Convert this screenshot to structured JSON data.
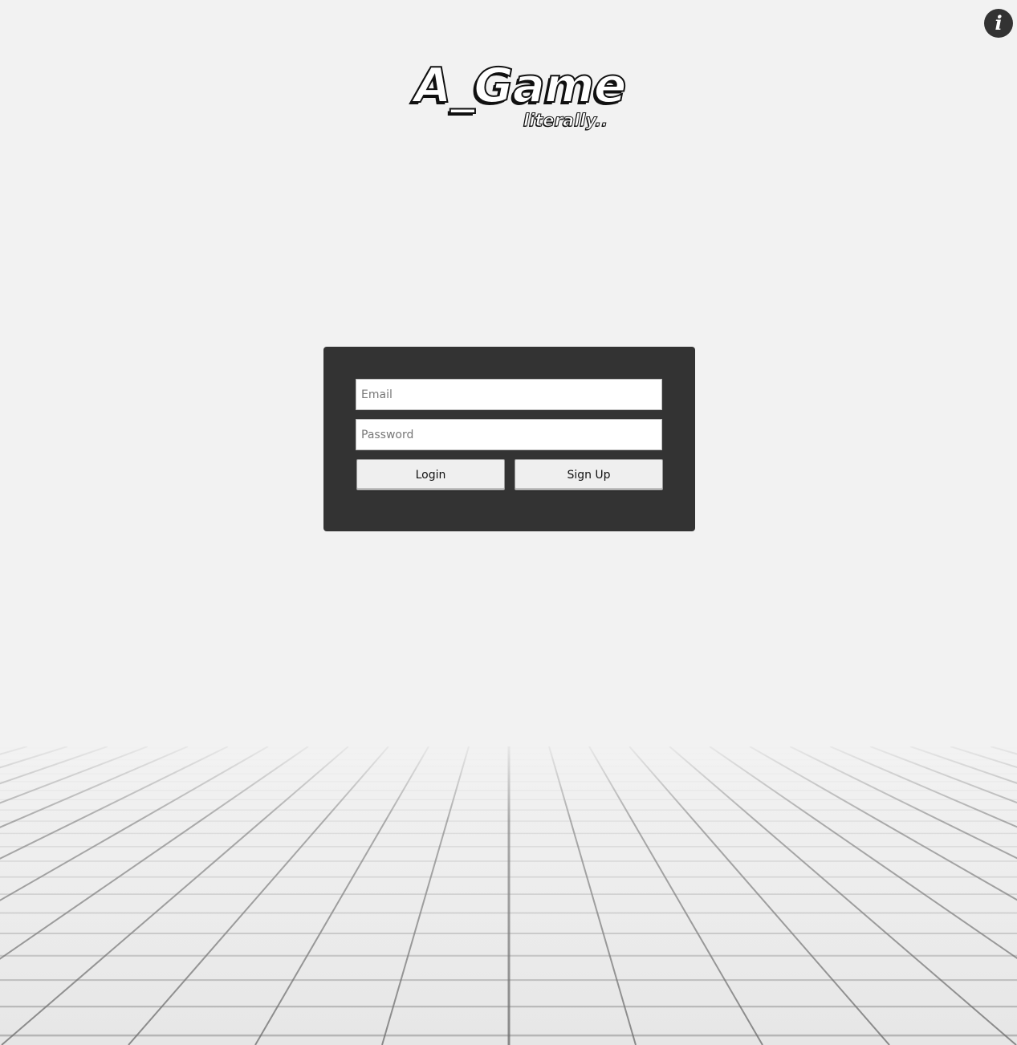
{
  "logo": {
    "title": "A_Game",
    "subtitle": "literally.."
  },
  "info_button": {
    "icon": "info-icon",
    "glyph": "i"
  },
  "login_form": {
    "email_placeholder": "Email",
    "password_placeholder": "Password",
    "login_label": "Login",
    "signup_label": "Sign Up"
  },
  "colors": {
    "background": "#f2f2f2",
    "panel": "#333333",
    "button": "#efefef",
    "info_button": "#333333"
  }
}
